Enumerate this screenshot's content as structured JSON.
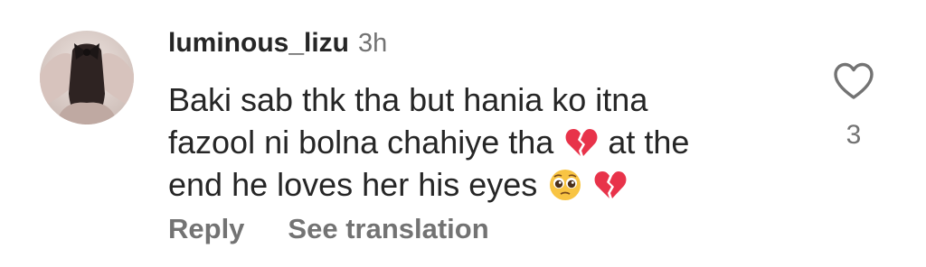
{
  "comment": {
    "username": "luminous_lizu",
    "timestamp": "3h",
    "text_lines": [
      "Baki sab thk tha but hania ko itna",
      "fazool ni bolna chahiye tha",
      "at the",
      "end he loves her his eyes"
    ],
    "emojis": {
      "line2": [
        "broken-heart"
      ],
      "line3": [
        "pleading-face",
        "broken-heart"
      ]
    },
    "like_count": "3",
    "actions": {
      "reply_label": "Reply",
      "translate_label": "See translation"
    }
  },
  "icons": {
    "like": "heart-outline-icon",
    "avatar": "user-avatar"
  },
  "colors": {
    "text_primary": "#262626",
    "text_secondary": "#737373",
    "broken_heart": "#e8334a",
    "pleading_face": "#f8c443"
  }
}
